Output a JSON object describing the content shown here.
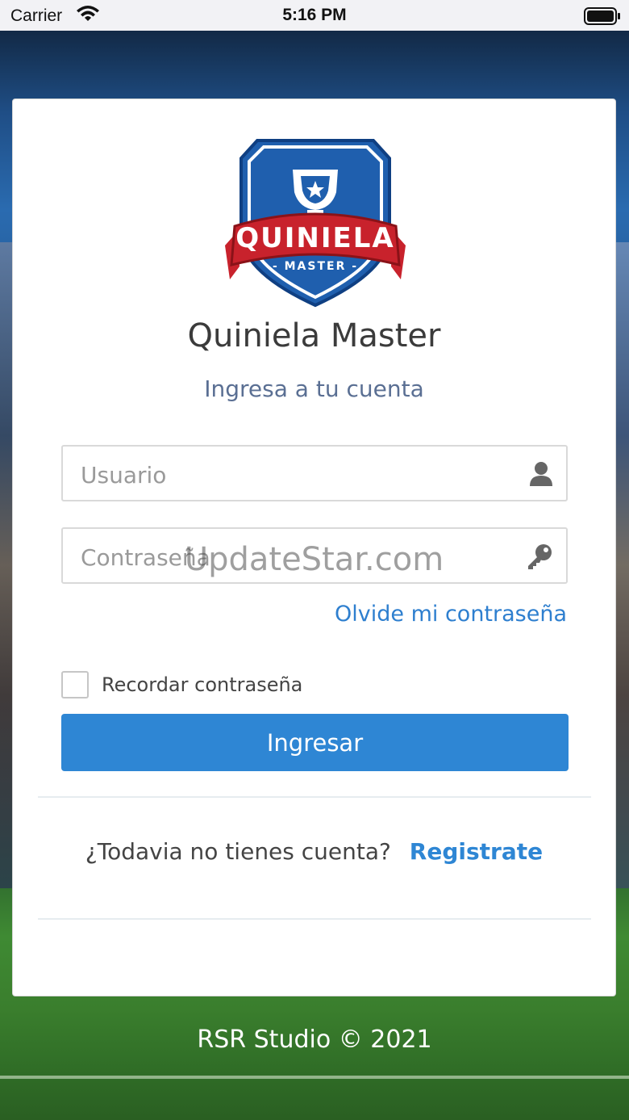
{
  "status_bar": {
    "carrier": "Carrier",
    "time": "5:16 PM"
  },
  "logo": {
    "banner_text": "QUINIELA",
    "sub_text": "- MASTER -",
    "colors": {
      "shield_blue": "#1f5fae",
      "banner_red": "#c8222c"
    }
  },
  "app_title": "Quiniela Master",
  "subtitle": "Ingresa a tu cuenta",
  "username": {
    "placeholder": "Usuario",
    "value": "",
    "icon": "user-icon"
  },
  "password": {
    "placeholder": "Contraseña",
    "value": "",
    "icon": "key-icon"
  },
  "watermark": "UpdateStar.com",
  "forgot_password": "Olvide mi contraseña",
  "remember": {
    "label": "Recordar contraseña",
    "checked": false
  },
  "login_button": "Ingresar",
  "signup": {
    "prompt": "¿Todavia no tienes cuenta?",
    "link": "Registrate"
  },
  "footer": "RSR Studio © 2021",
  "colors": {
    "primary": "#2e86d4",
    "link": "#2e7fcf",
    "subtitle": "#5a6f93"
  }
}
